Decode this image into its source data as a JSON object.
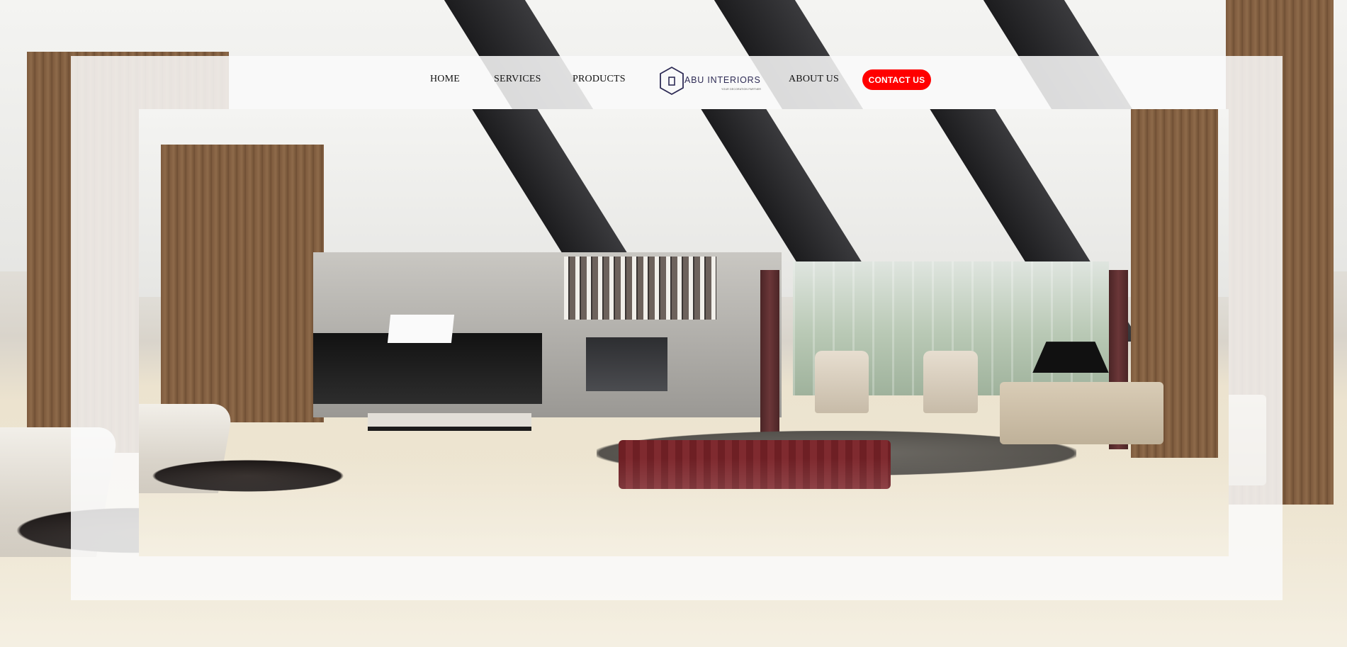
{
  "nav": {
    "home": "HOME",
    "services": "SERVICES",
    "products": "PRODUCTS",
    "about": "ABOUT US",
    "contact": "CONTACT US"
  },
  "logo": {
    "brand": "ABU INTERIORS",
    "tagline": "YOUR DECORATION PARTNER",
    "icon": "house-hexagon-icon"
  },
  "hero": {
    "image": "living-room-interior-photo"
  },
  "colors": {
    "contact_button": "#ff0000",
    "brand_text": "#2e2b55"
  }
}
